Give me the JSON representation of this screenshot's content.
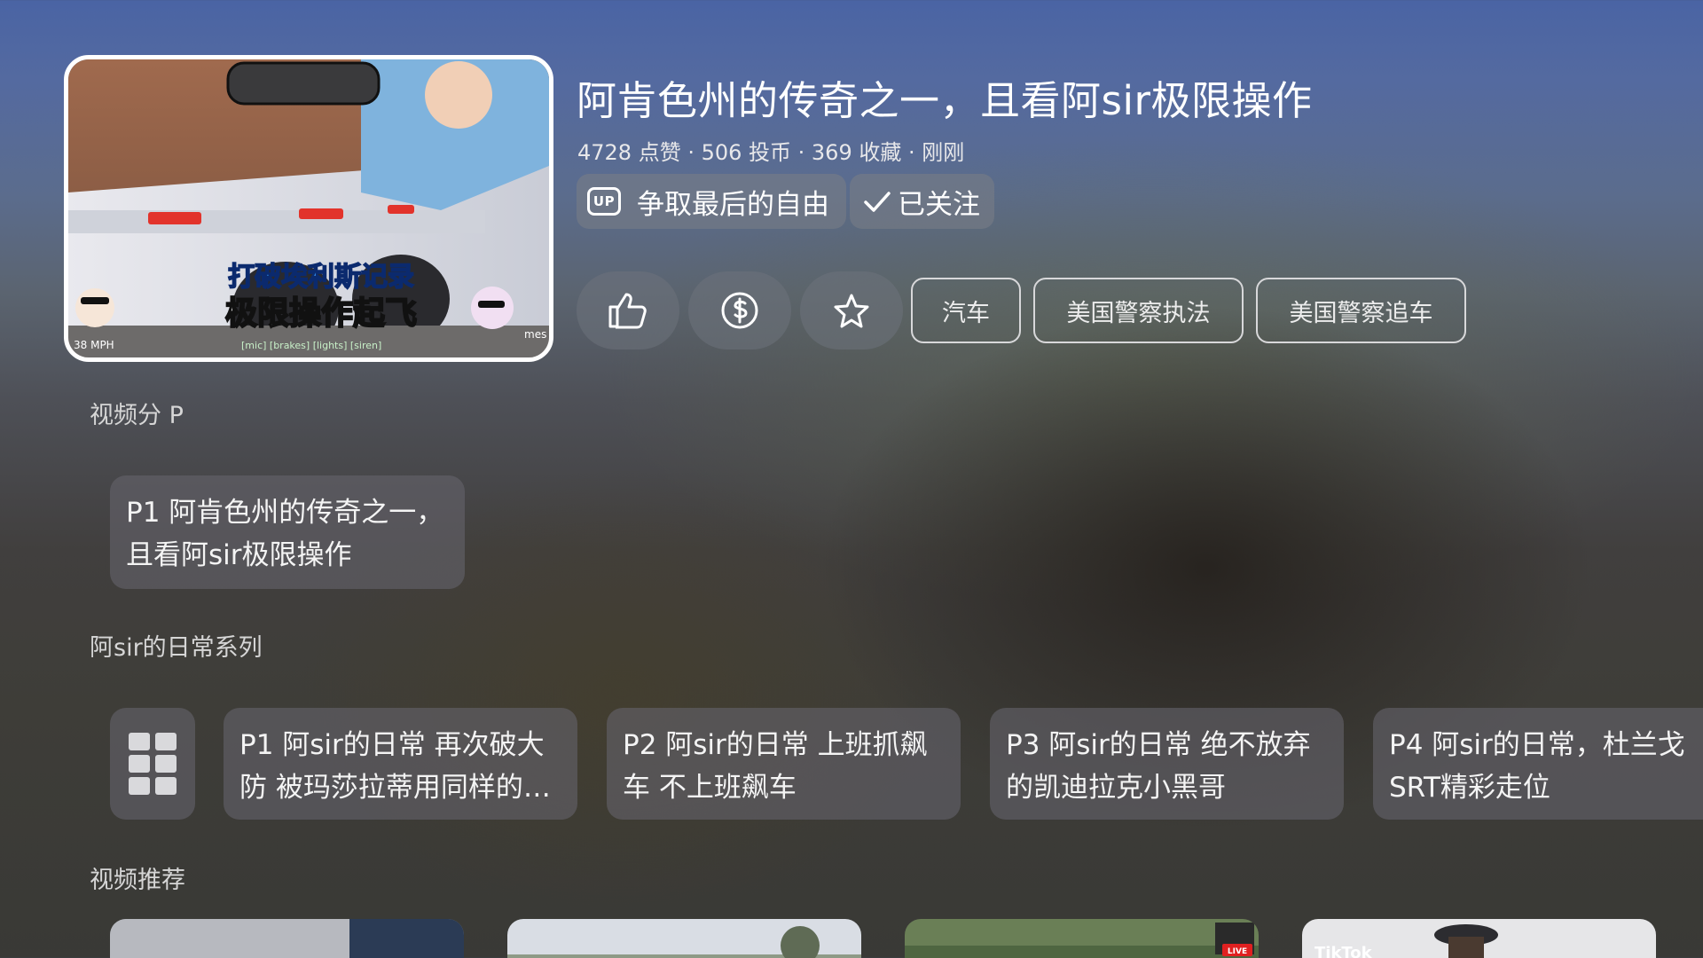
{
  "video": {
    "title": "阿肯色州的传奇之一，且看阿sir极限操作",
    "stats": "4728 点赞 · 506 投币 · 369 收藏 · 刚刚",
    "thumbnail": {
      "caption_line1": "打破埃利斯记录",
      "caption_line2": "极限操作起飞",
      "speed_text": "38 MPH",
      "hud_text": "[mic] [brakes] [lights] [siren]",
      "corner_text": "mes"
    }
  },
  "uploader": {
    "badge": "UP",
    "name": "争取最后的自由",
    "follow_label": "已关注",
    "follow_icon": "check-icon"
  },
  "actions": [
    {
      "name": "like",
      "icon": "thumbs-up-icon"
    },
    {
      "name": "coin",
      "icon": "coin-dollar-icon"
    },
    {
      "name": "favorite",
      "icon": "star-icon"
    }
  ],
  "tags": [
    "汽车",
    "美国警察执法",
    "美国警察追车"
  ],
  "sections": {
    "parts_label": "视频分 P",
    "series_label": "阿sir的日常系列",
    "recommend_label": "视频推荐"
  },
  "parts": [
    {
      "label": "P1 阿肯色州的传奇之一，且看阿sir极限操作"
    }
  ],
  "series": {
    "grid_icon": "grid-icon",
    "items": [
      {
        "label": "P1 阿sir的日常 再次破大防 被玛莎拉蒂用同样的…"
      },
      {
        "label": "P2 阿sir的日常 上班抓飙车 不上班飙车"
      },
      {
        "label": "P3 阿sir的日常 绝不放弃的凯迪拉克小黑哥"
      },
      {
        "label": "P4 阿sir的日常，杜兰戈SRT精彩走位"
      }
    ]
  },
  "recommendations": [
    {
      "badge": ""
    },
    {
      "badge": ""
    },
    {
      "badge": "LIVE"
    },
    {
      "badge": "TikTok"
    }
  ],
  "colors": {
    "accent_white": "#ffffff",
    "pill_bg": "#787c86",
    "card_bg": "#64626a"
  }
}
